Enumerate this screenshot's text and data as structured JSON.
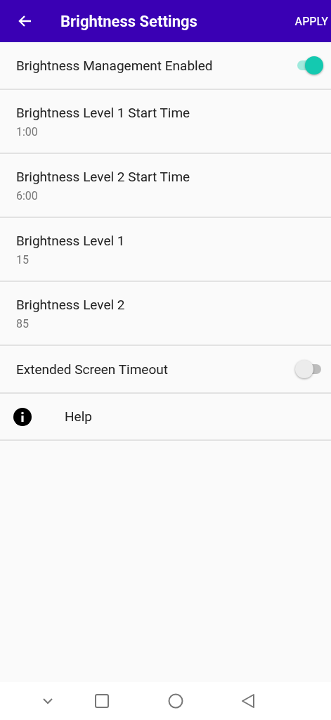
{
  "app_bar": {
    "title": "Brightness Settings",
    "action": "APPLY"
  },
  "settings": [
    {
      "kind": "switch",
      "label": "Brightness Management Enabled",
      "on": true
    },
    {
      "kind": "value",
      "label": "Brightness Level 1 Start Time",
      "value": "1:00"
    },
    {
      "kind": "value",
      "label": "Brightness Level 2 Start Time",
      "value": "6:00"
    },
    {
      "kind": "value",
      "label": "Brightness Level 1",
      "value": "15"
    },
    {
      "kind": "value",
      "label": "Brightness Level 2",
      "value": "85"
    },
    {
      "kind": "switch",
      "label": "Extended Screen Timeout",
      "on": false
    },
    {
      "kind": "info",
      "label": "Help"
    }
  ]
}
